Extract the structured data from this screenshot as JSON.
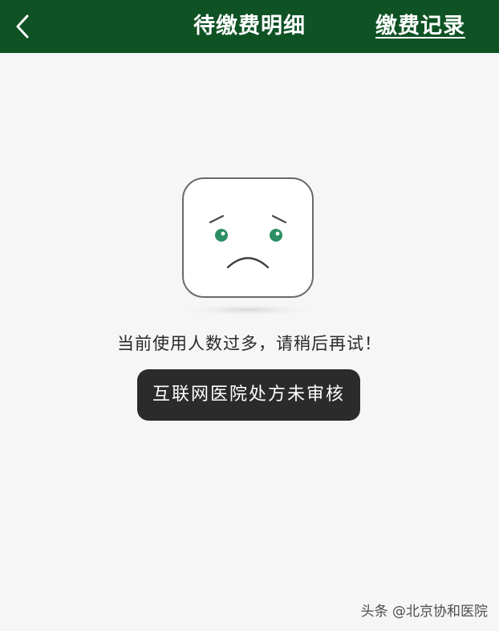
{
  "header": {
    "title": "待缴费明细",
    "record_link": "缴费记录",
    "back_icon": "chevron-left-icon",
    "background_color": "#0f5224"
  },
  "error": {
    "illustration": "sad-face-icon",
    "message": "当前使用人数过多，请稍后再试！"
  },
  "toast": {
    "text": "互联网医院处方未审核"
  },
  "watermark": {
    "text": "头条 @北京协和医院"
  }
}
